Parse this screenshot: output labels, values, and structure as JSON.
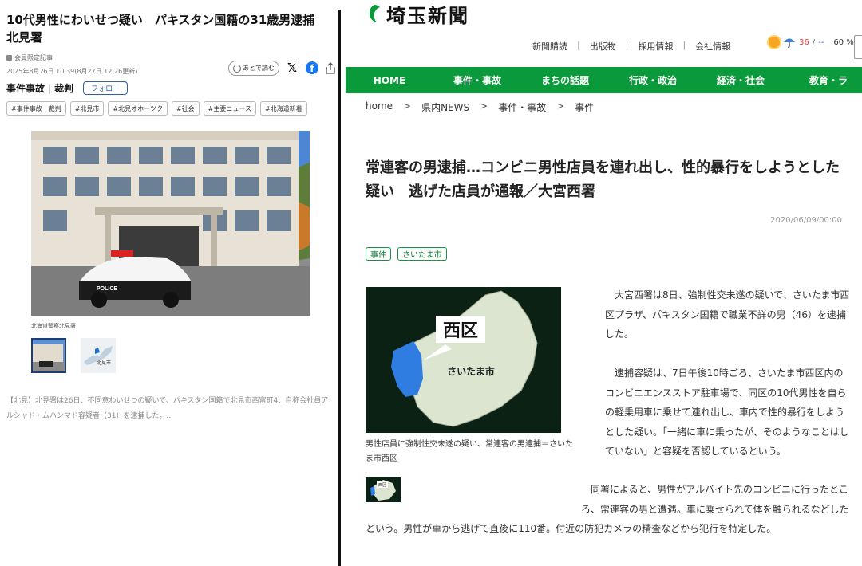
{
  "left": {
    "title": "10代男性にわいせつ疑い　パキスタン国籍の31歳男逮捕　北見署",
    "members_only": "会員限定記事",
    "date": "2025年8月26日 10:39(8月27日 12:26更新)",
    "read_later": "あとで読む",
    "category": "事件事故",
    "subcategory": "裁判",
    "follow": "フォロー",
    "tags": [
      "#事件事故｜裁判",
      "#北見市",
      "#北見オホーツク",
      "#社会",
      "#主要ニュース",
      "#北海道新着"
    ],
    "photo": {
      "car_text": "POLICE"
    },
    "photo_caption": "北海道警察北見署",
    "thumb2_label": "北見市",
    "body": "【北見】北見署は26日、不同意わいせつの疑いで、パキスタン国籍で北見市西富町4、自称会社員アルシャド・ムハンマド容疑者（31）を逮捕した。..."
  },
  "right": {
    "logo": "埼玉新聞",
    "util_links": [
      "新聞購読",
      "出版物",
      "採用情報",
      "会社情報"
    ],
    "weather": {
      "high": "36",
      "sep": "/",
      "low": "--",
      "rain": "60 %"
    },
    "nav": [
      "HOME",
      "事件・事故",
      "まちの話題",
      "行政・政治",
      "経済・社会",
      "教育・ラ"
    ],
    "breadcrumb": [
      "home",
      "県内NEWS",
      "事件・事故",
      "事件"
    ],
    "breadcrumb_sep": ">",
    "title": "常連客の男逮捕…コンビニ男性店員を連れ出し、性的暴行をしようとした疑い　逃げた店員が通報／大宮西署",
    "date": "2020/06/09/00:00",
    "tags": [
      "事件",
      "さいたま市"
    ],
    "map": {
      "ward": "西区",
      "city": "さいたま市"
    },
    "map_caption": "男性店員に強制性交未遂の疑い、常連客の男逮捕＝さいたま市西区",
    "map_thumb_label": "西区",
    "paragraphs": [
      "　大宮西署は8日、強制性交未遂の疑いで、さいたま市西区プラザ、パキスタン国籍で職業不詳の男（46）を逮捕した。",
      "　逮捕容疑は、7日午後10時ごろ、さいたま市西区内のコンビニエンスストア駐車場で、同区の10代男性を自らの軽乗用車に乗せて連れ出し、車内で性的暴行をしようとした疑い。「一緒に車に乗ったが、そのようなことはしていない」と容疑を否認しているという。",
      "　同署によると、男性がアルバイト先のコンビニに行ったところ、常連客の男と遭遇。車に乗せられて体を触られるなどしたという。男性が車から逃げて直後に110番。付近の防犯カメラの精査などから犯行を特定した。"
    ]
  },
  "colors": {
    "nav_green": "#0a9a3c",
    "map_dark": "#0b2114",
    "map_land": "#dbe5cf",
    "map_blue": "#2f7de0",
    "follow_blue": "#2d5fa8"
  }
}
